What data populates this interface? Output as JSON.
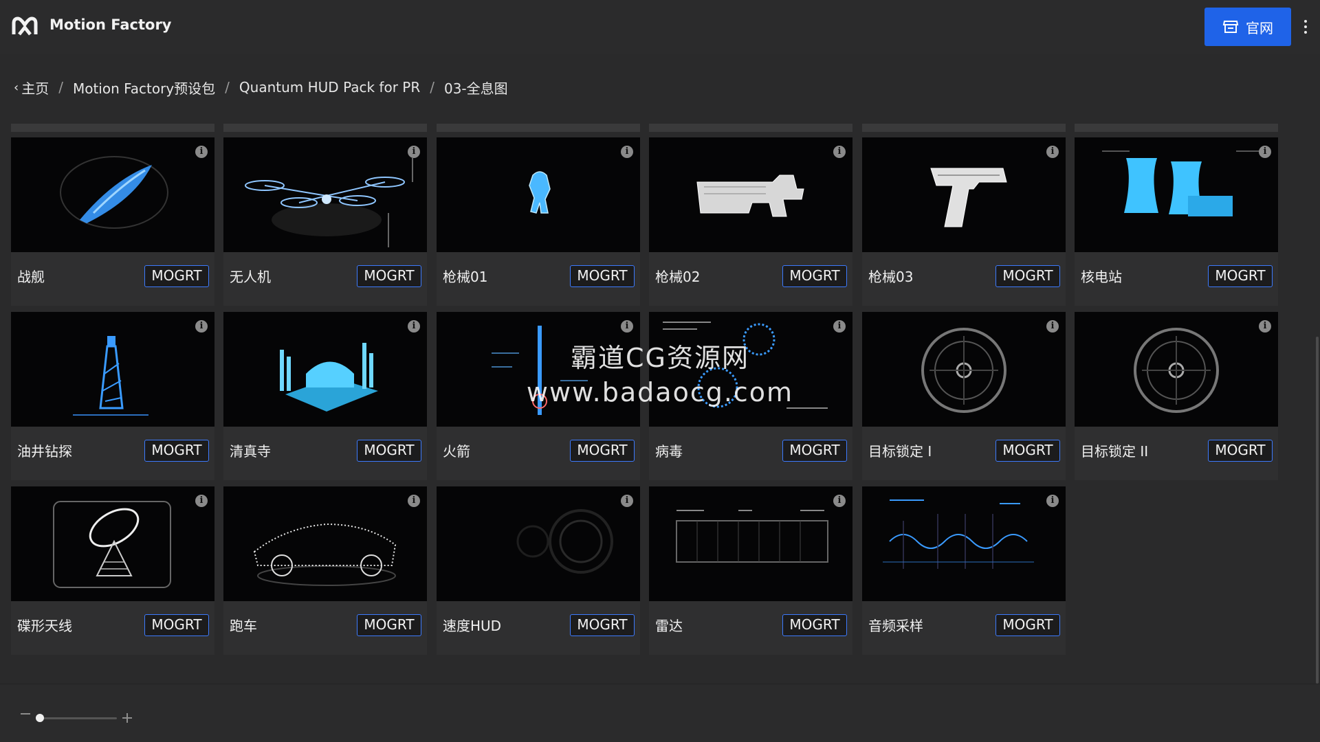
{
  "header": {
    "app_title": "Motion Factory",
    "site_button_label": "官网",
    "accent_color": "#1f63e8"
  },
  "breadcrumb": {
    "items": [
      "主页",
      "Motion Factory预设包",
      "Quantum HUD Pack for PR",
      "03-全息图"
    ]
  },
  "grid": {
    "button_label": "MOGRT",
    "info_glyph": "i",
    "items": [
      {
        "label": "战舰",
        "icon": "battleship-hologram"
      },
      {
        "label": "无人机",
        "icon": "drone-hologram"
      },
      {
        "label": "枪械01",
        "icon": "figure-hologram"
      },
      {
        "label": "枪械02",
        "icon": "gun-hologram"
      },
      {
        "label": "枪械03",
        "icon": "pistol-hologram"
      },
      {
        "label": "核电站",
        "icon": "nuclear-plant-hologram"
      },
      {
        "label": "油井钻探",
        "icon": "oil-rig-hologram"
      },
      {
        "label": "清真寺",
        "icon": "mosque-hologram"
      },
      {
        "label": "火箭",
        "icon": "rocket-hologram"
      },
      {
        "label": "病毒",
        "icon": "virus-hologram"
      },
      {
        "label": "目标锁定 I",
        "icon": "target-lock-hologram"
      },
      {
        "label": "目标锁定 II",
        "icon": "target-lock-hologram"
      },
      {
        "label": "碟形天线",
        "icon": "satellite-dish-hologram"
      },
      {
        "label": "跑车",
        "icon": "sports-car-hologram"
      },
      {
        "label": "速度HUD",
        "icon": "speed-hud-hologram"
      },
      {
        "label": "雷达",
        "icon": "radar-hologram"
      },
      {
        "label": "音频采样",
        "icon": "audio-sample-hologram"
      }
    ]
  },
  "watermark": {
    "line1": "霸道CG资源网",
    "line2": "www.badaocg.com"
  },
  "footer": {
    "zoom_level": 0
  }
}
